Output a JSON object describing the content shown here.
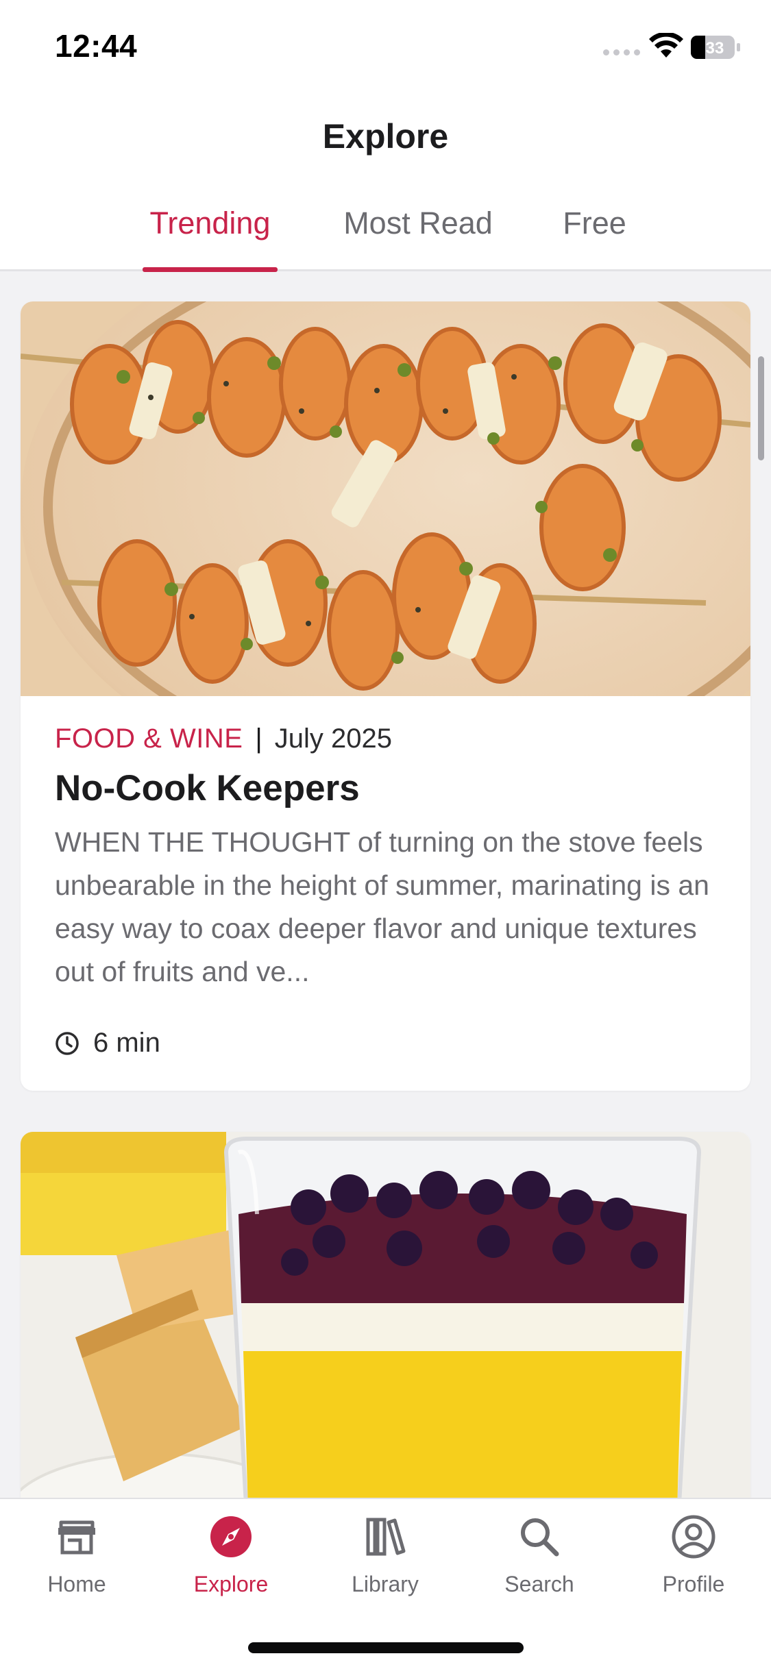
{
  "status_bar": {
    "time": "12:44",
    "battery_level": "33",
    "icons": [
      "signal-dots-icon",
      "wifi-icon",
      "battery-icon"
    ]
  },
  "header": {
    "title": "Explore",
    "tabs": [
      {
        "label": "Trending",
        "active": true
      },
      {
        "label": "Most Read",
        "active": false
      },
      {
        "label": "Free",
        "active": false
      }
    ]
  },
  "articles": [
    {
      "source": "FOOD & WINE",
      "separator": "|",
      "date": "July 2025",
      "title": "No-Cook Keepers",
      "excerpt": "WHEN THE THOUGHT of turning on the stove feels unbearable in the height of summer, marinating is an easy way to coax deeper flavor and unique textures out of fruits and ve...",
      "read_time": "6 min",
      "image": "marinated-melon-skewers-photo"
    },
    {
      "image": "lemon-curd-blueberry-parfait-photo"
    }
  ],
  "bottom_nav": {
    "items": [
      {
        "label": "Home",
        "icon": "storefront-icon",
        "active": false
      },
      {
        "label": "Explore",
        "icon": "compass-icon",
        "active": true
      },
      {
        "label": "Library",
        "icon": "books-icon",
        "active": false
      },
      {
        "label": "Search",
        "icon": "magnifier-icon",
        "active": false
      },
      {
        "label": "Profile",
        "icon": "person-circle-icon",
        "active": false
      }
    ]
  },
  "colors": {
    "accent": "#c8234a",
    "background": "#f2f2f4",
    "text_secondary": "#6b6b70"
  }
}
